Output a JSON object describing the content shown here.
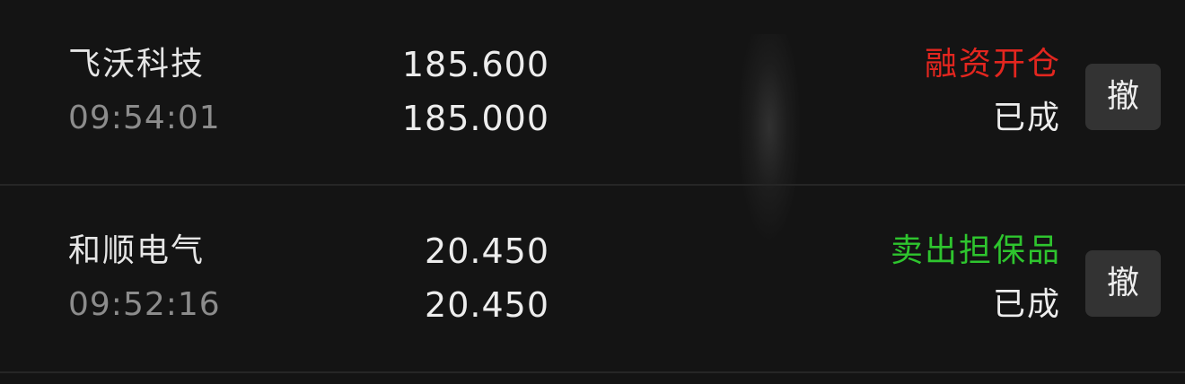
{
  "orders": [
    {
      "name": "飞沃科技",
      "time": "09:54:01",
      "order_price": "185.600",
      "fill_price": "185.000",
      "business": "融资开仓",
      "business_color": "#e3261f",
      "status": "已成",
      "cancel_label": "撤"
    },
    {
      "name": "和顺电气",
      "time": "09:52:16",
      "order_price": "20.450",
      "fill_price": "20.450",
      "business": "卖出担保品",
      "business_color": "#2ec52e",
      "status": "已成",
      "cancel_label": "撤"
    }
  ]
}
